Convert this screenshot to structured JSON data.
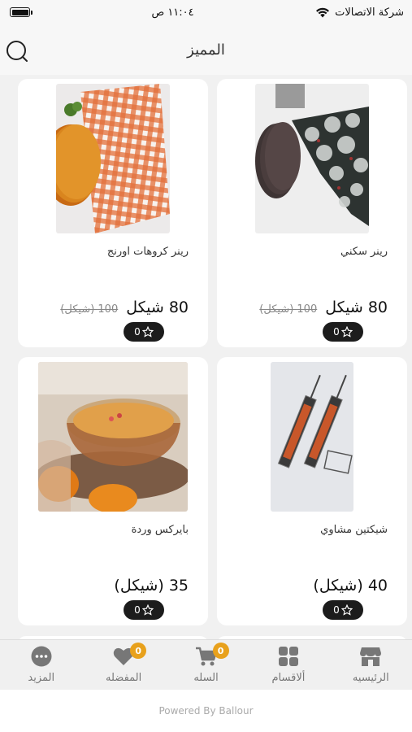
{
  "status_bar": {
    "carrier": "شركة الاتصالات",
    "time": "١١:٠٤ ص"
  },
  "header": {
    "title": "المميز",
    "search_icon": "search-icon"
  },
  "products": [
    {
      "name": "رينر سكني",
      "price": "80 شيكل",
      "old_price": "100 (شيكل)",
      "rating": "0",
      "image": "floral-runner-with-placemats"
    },
    {
      "name": "رينر كروهات اورنج",
      "price": "80 شيكل",
      "old_price": "100 (شيكل)",
      "rating": "0",
      "image": "orange-checkered-runner"
    },
    {
      "name": "شيكتين مشاوي",
      "price": "40 (شيكل)",
      "old_price": "",
      "rating": "0",
      "image": "grill-baskets"
    },
    {
      "name": "بايركس وردة",
      "price": "35 (شيكل)",
      "old_price": "",
      "rating": "0",
      "image": "pyrex-flower-dish"
    }
  ],
  "bottom_nav": {
    "items": [
      {
        "label": "الرئيسيه",
        "icon": "store-icon"
      },
      {
        "label": "ألاقسام",
        "icon": "grid-icon"
      },
      {
        "label": "السله",
        "icon": "cart-icon",
        "badge": "0"
      },
      {
        "label": "المفضله",
        "icon": "heart-icon",
        "badge": "0"
      },
      {
        "label": "المزيد",
        "icon": "more-icon"
      }
    ]
  },
  "footer": {
    "text": "Powered By Ballour"
  },
  "colors": {
    "badge": "#e8a11c",
    "rating_pill": "#1c1c1c",
    "background": "#f1f1f1"
  }
}
